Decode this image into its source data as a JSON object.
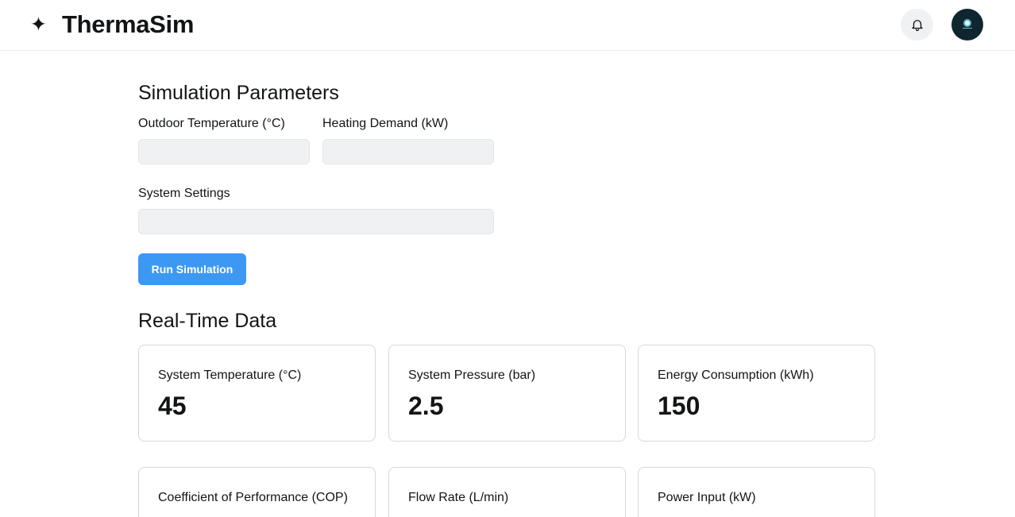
{
  "header": {
    "logo_glyph": "✦",
    "app_title": "ThermaSim"
  },
  "parameters": {
    "title": "Simulation Parameters",
    "outdoor_temp": {
      "label": "Outdoor Temperature (°C)",
      "value": "",
      "placeholder": ""
    },
    "heating_demand": {
      "label": "Heating Demand (kW)",
      "value": "",
      "placeholder": ""
    },
    "system_settings": {
      "label": "System Settings",
      "value": "",
      "placeholder": ""
    },
    "run_button_label": "Run Simulation"
  },
  "realtime": {
    "title": "Real-Time Data",
    "cards": [
      {
        "label": "System Temperature (°C)",
        "value": "45"
      },
      {
        "label": "System Pressure (bar)",
        "value": "2.5"
      },
      {
        "label": "Energy Consumption (kWh)",
        "value": "150"
      },
      {
        "label": "Coefficient of Performance (COP)",
        "value": ""
      },
      {
        "label": "Flow Rate (L/min)",
        "value": ""
      },
      {
        "label": "Power Input (kW)",
        "value": ""
      }
    ]
  },
  "icons": {
    "logo": "sparkle-icon",
    "notifications": "bell-icon",
    "avatar": "user-avatar"
  },
  "colors": {
    "accent": "#3d98f4",
    "input_bg": "#f0f1f2",
    "card_border": "#d5d8db",
    "avatar_bg": "#10262e"
  }
}
